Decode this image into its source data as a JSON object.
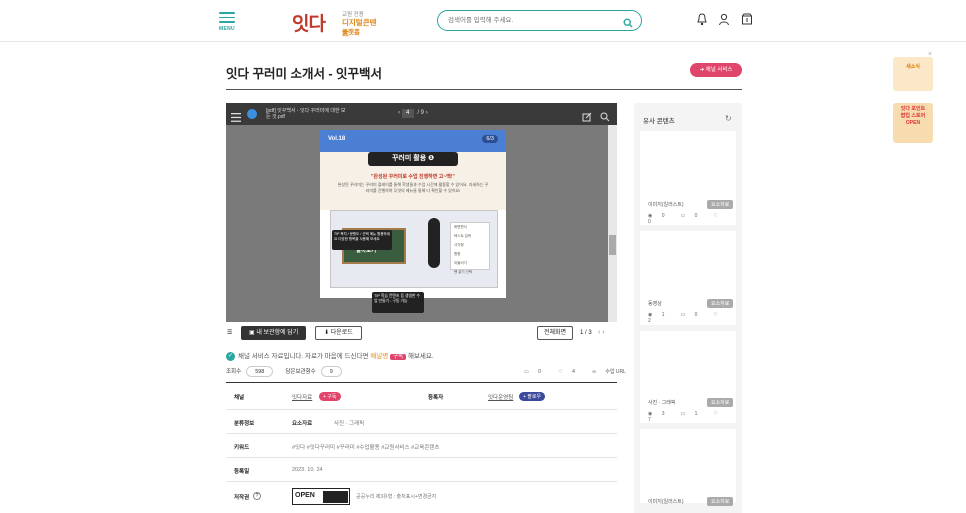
{
  "header": {
    "menu_label": "MENU",
    "logo_main": "잇다",
    "logo_sub1": "교원 전용",
    "logo_sub2": "디지털콘텐츠",
    "logo_sub3": "플랫폼",
    "search_placeholder": "검색어를 입력해 주세요."
  },
  "page": {
    "title": "잇다 꾸러미 소개서 - 잇꾸백서",
    "channel_button": "채널 서비스"
  },
  "viewer": {
    "file_name": "[pdf] 잇꾸백서 - 잇다 꾸러미에 대한 모든 것.pdf",
    "page_current": "4",
    "page_total": "/ 9",
    "doc_vol": "Vol.18",
    "doc_page": "6/3",
    "doc_heading": "꾸러미 활용 ❶",
    "doc_sub": "\"완성된 꾸러미로 수업 진행하면 고~백!\"",
    "doc_para": "완성된 꾸러미는 꾸러미 플레이를 통해 학생들과 수업 시간에 활용할 수 있어요. 자세하는 꾸러미를 진행하며 무엇의 메뉴들 통해 다 확인할 수 있어요!",
    "doc_board": "알아보기",
    "doc_tip_left": "TIP 목차 / 문항도 / 선택 메뉴 활용하세요 다양한 항목을 사용해 보세요",
    "doc_tip_bottom": "TIP 학습 컨텐츠 등 생생한 수업 만들기 - 구동 가능",
    "doc_menu_items": [
      "화면판서",
      "텍스트 입력",
      "사각형",
      "원형",
      "되돌리기",
      "펜 굵기 선택"
    ]
  },
  "controls": {
    "save_label": "내 보관함에 담기",
    "download_label": "다운로드",
    "fullscreen_label": "전체화면",
    "page_indicator": "1 / 3"
  },
  "notice": {
    "prefix": "채널 서비스 자료입니다. 자료가 마음에 드신다면 ",
    "channel": "채널명",
    "subscribe": "구독",
    "suffix": " 해보세요."
  },
  "stats": {
    "views_label": "조회수",
    "views_value": "598",
    "saves_label": "담은보관함수",
    "saves_value": "9",
    "comments": "0",
    "likes": "4",
    "share": "수업 URL",
    "report": "신고"
  },
  "info": {
    "channel_label": "채널",
    "channel_value": "잇다자료",
    "subscribe_btn": "+ 구독",
    "registrant_label": "등록자",
    "registrant_value": "잇다운영팀",
    "follow_btn": "+ 팔로우",
    "category_label": "분류정보",
    "category_value1": "요소자료",
    "category_value2": "사진 · 그래픽",
    "keyword_label": "키워드",
    "keywords": "#잇다 #잇다꾸러미 #꾸러미 #수업활용 #교원서비스 #교육콘텐츠",
    "date_label": "등록일",
    "date_value": "2023. 10. 24",
    "copyright_label": "저작권",
    "copyright_text": "공공누리 제3유형 : 출처표시+변경금지",
    "open_label": "OPEN"
  },
  "sidebar": {
    "title": "유사 콘텐츠",
    "cards": [
      {
        "type": "이미지(일러스트)",
        "badge": "요소자료",
        "views": "0",
        "comments": "0",
        "likes": "0"
      },
      {
        "type": "동영상",
        "badge": "요소자료",
        "views": "1",
        "comments": "0",
        "likes": "2"
      },
      {
        "type": "사진 · 그래픽",
        "badge": "요소자료",
        "views": "3",
        "comments": "1",
        "likes": "7"
      },
      {
        "type": "이미지(일러스트)",
        "badge": "요소자료",
        "views": "",
        "comments": "",
        "likes": ""
      }
    ]
  },
  "floating": {
    "banner1": "새소식",
    "banner2_line1": "잇다 포인트",
    "banner2_line2": "팝업 스토어",
    "banner2_line3": "OPEN"
  }
}
